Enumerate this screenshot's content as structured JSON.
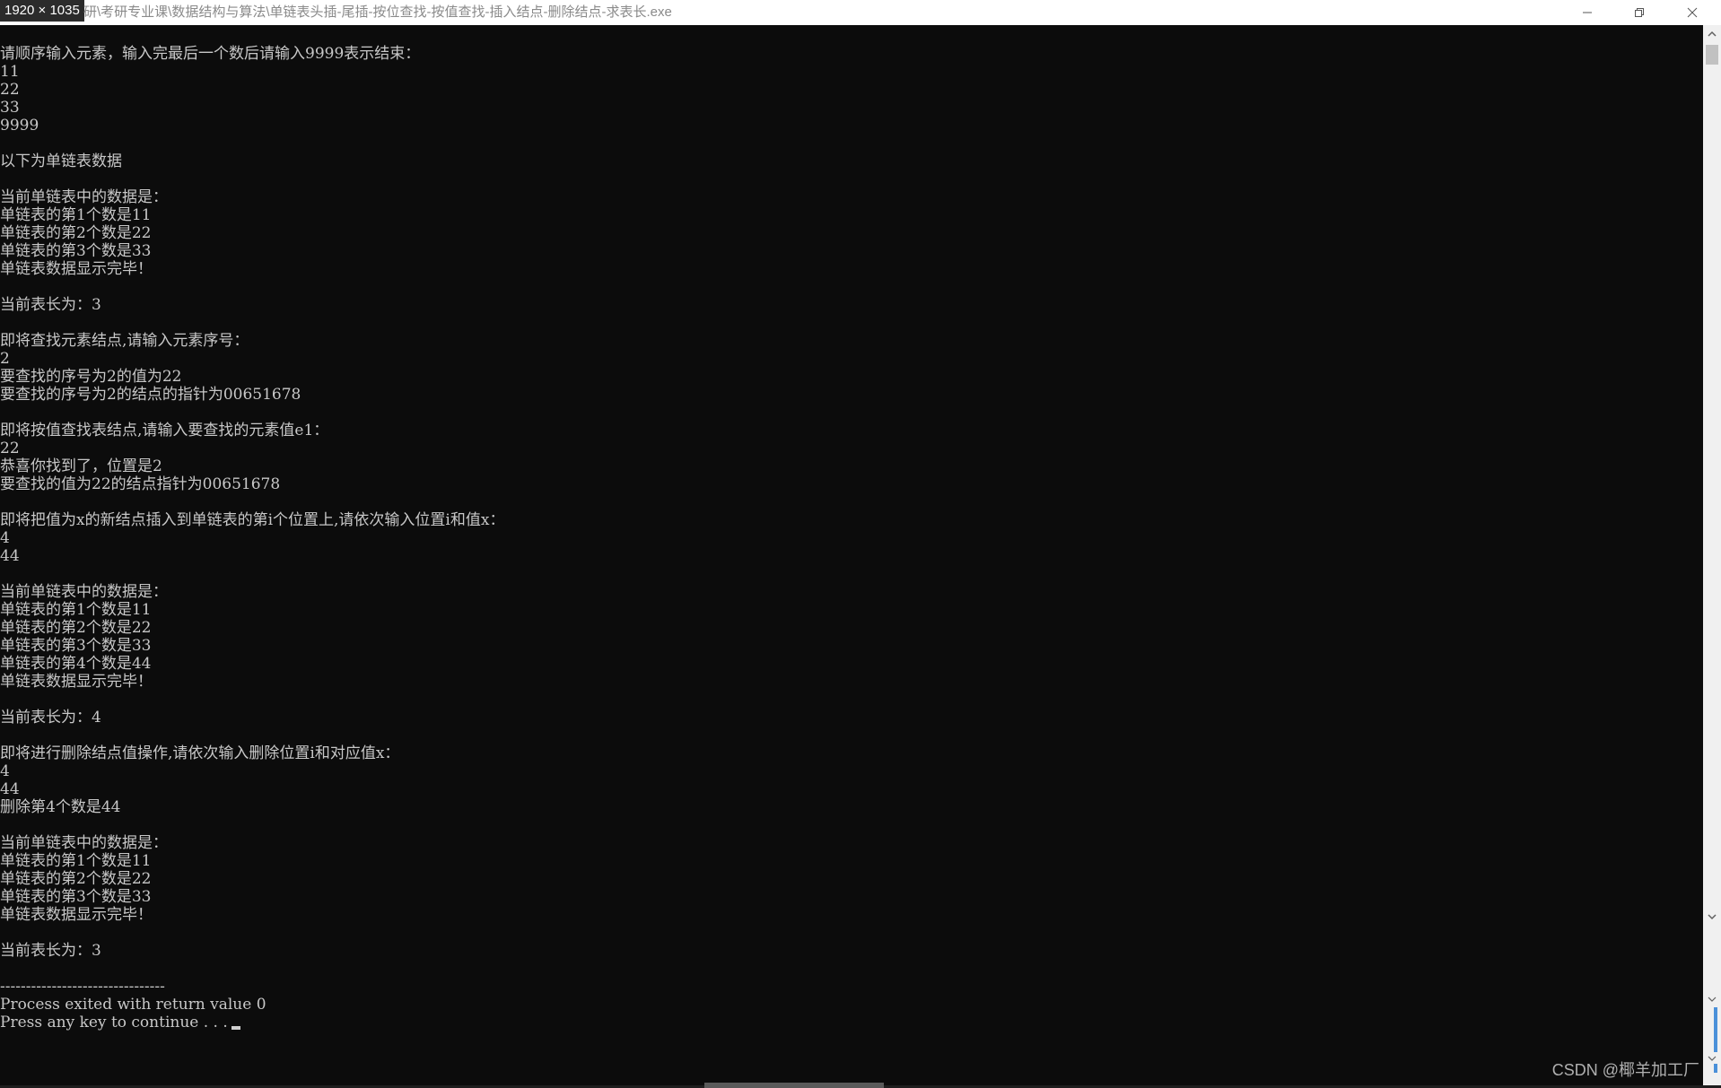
{
  "window": {
    "dimensions_label": "1920 × 1035",
    "title": "研\\考研专业课\\数据结构与算法\\单链表头插-尾插-按位查找-按值查找-插入结点-删除结点-求表长.exe"
  },
  "console": {
    "lines": [
      "请顺序输入元素，输入完最后一个数后请输入9999表示结束：",
      "11",
      "22",
      "33",
      "9999",
      "",
      "以下为单链表数据",
      "",
      "当前单链表中的数据是：",
      "单链表的第1个数是11",
      "单链表的第2个数是22",
      "单链表的第3个数是33",
      "单链表数据显示完毕！",
      "",
      "当前表长为：3",
      "",
      "即将查找元素结点,请输入元素序号：",
      "2",
      "要查找的序号为2的值为22",
      "要查找的序号为2的结点的指针为00651678",
      "",
      "即将按值查找表结点,请输入要查找的元素值e1：",
      "22",
      "恭喜你找到了，位置是2",
      "要查找的值为22的结点指针为00651678",
      "",
      "即将把值为x的新结点插入到单链表的第i个位置上,请依次输入位置i和值x：",
      "4",
      "44",
      "",
      "当前单链表中的数据是：",
      "单链表的第1个数是11",
      "单链表的第2个数是22",
      "单链表的第3个数是33",
      "单链表的第4个数是44",
      "单链表数据显示完毕！",
      "",
      "当前表长为：4",
      "",
      "即将进行删除结点值操作,请依次输入删除位置i和对应值x：",
      "4",
      "44",
      "删除第4个数是44",
      "",
      "当前单链表中的数据是：",
      "单链表的第1个数是11",
      "单链表的第2个数是22",
      "单链表的第3个数是33",
      "单链表数据显示完毕！",
      "",
      "当前表长为：3",
      "",
      "--------------------------------",
      "Process exited with return value 0",
      "Press any key to continue . . ."
    ]
  },
  "watermark": "CSDN @椰羊加工厂",
  "colors": {
    "console_bg": "#0c0c0c",
    "console_text": "#c8c8c8",
    "titlebar_bg": "#ffffff"
  },
  "icons": [
    "minimize-icon",
    "maximize-icon",
    "close-icon",
    "scroll-up-icon",
    "scroll-down-icon"
  ]
}
